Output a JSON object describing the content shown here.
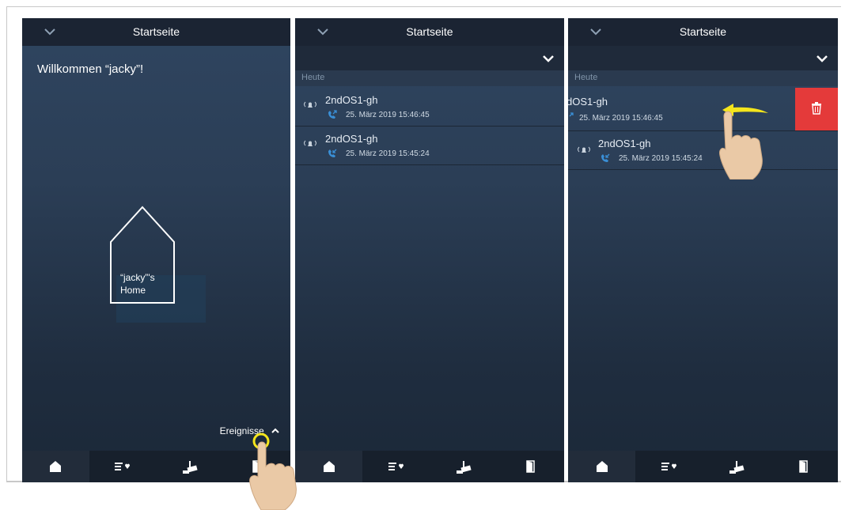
{
  "screens": [
    {
      "header_title": "Startseite",
      "welcome": "Willkommen “jacky”!",
      "home_label_line1": "“jacky”'s",
      "home_label_line2": "Home",
      "events_label": "Ereignisse"
    },
    {
      "header_title": "Startseite",
      "section_label": "Heute",
      "events": [
        {
          "name": "2ndOS1-gh",
          "time": "25. März 2019 15:46:45",
          "call_icon": "outgoing-call-icon"
        },
        {
          "name": "2ndOS1-gh",
          "time": "25. März 2019 15:45:24",
          "call_icon": "missed-call-icon"
        }
      ]
    },
    {
      "header_title": "Startseite",
      "section_label": "Heute",
      "events": [
        {
          "name": "dOS1-gh",
          "time": "25. März 2019 15:46:45",
          "call_icon": "outgoing-call-icon"
        },
        {
          "name": "2ndOS1-gh",
          "time": "25. März 2019 15:45:24",
          "call_icon": "missed-call-icon"
        }
      ]
    }
  ],
  "nav_icons": [
    "home-icon",
    "events-list-icon",
    "camera-icon",
    "door-icon"
  ],
  "colors": {
    "delete": "#e43a3a",
    "gesture": "#f4e51c",
    "call_icon": "#3a8fd6"
  }
}
